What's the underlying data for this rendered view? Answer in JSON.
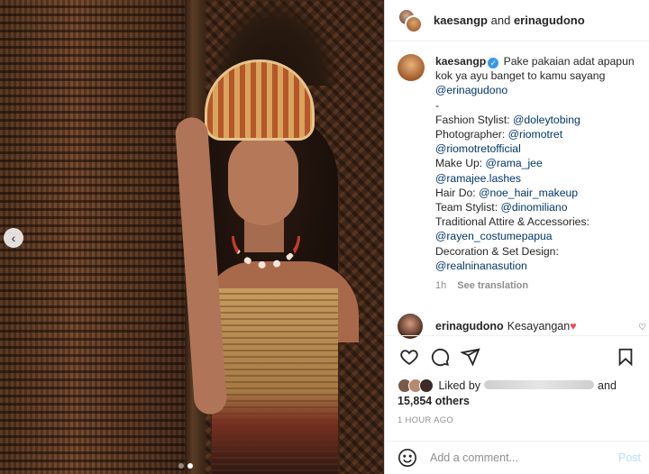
{
  "header": {
    "user1": "kaesangp",
    "connector": "and",
    "user2": "erinagudono"
  },
  "caption": {
    "username": "kaesangp",
    "verified_glyph": "✓",
    "text": "Pake pakaian adat apapun kok ya ayu banget to kamu sayang ",
    "mention_main": "@erinagudono",
    "separator": "-",
    "credits": [
      {
        "label": "Fashion Stylist: ",
        "handles": [
          "@doleytobing"
        ]
      },
      {
        "label": "Photographer: ",
        "handles": [
          "@riomotret",
          "@riomotretofficial"
        ]
      },
      {
        "label": "Make Up: ",
        "handles": [
          "@rama_jee",
          "@ramajee.lashes"
        ]
      },
      {
        "label": "Hair Do: ",
        "handles": [
          "@noe_hair_makeup"
        ]
      },
      {
        "label": "Team Stylist: ",
        "handles": [
          "@dinomiliano"
        ]
      },
      {
        "label": "Traditional Attire & Accessories: ",
        "handles": [
          "@rayen_costumepapua"
        ]
      },
      {
        "label": "Decoration & Set Design: ",
        "handles": [
          "@realninanasution"
        ]
      }
    ],
    "age": "1h",
    "see_translation": "See translation"
  },
  "comment": {
    "username": "erinagudono",
    "text": "Kesayangan",
    "heart": "♥",
    "like_icon": "♡"
  },
  "actions": {
    "icons": [
      "heart-icon",
      "comment-icon",
      "share-icon",
      "bookmark-icon"
    ]
  },
  "likes": {
    "prefix": "Liked by",
    "connector": "and",
    "count": "15,854 others"
  },
  "timestamp": "1 HOUR AGO",
  "add_comment": {
    "placeholder": "Add a comment...",
    "post_label": "Post"
  },
  "carousel": {
    "prev_glyph": "‹",
    "current_slide": 2,
    "total_slides": 2
  },
  "colors": {
    "link": "#00376b",
    "verified": "#3897f0",
    "heart": "#ed4956",
    "post_button_disabled": "#b2dffc"
  }
}
